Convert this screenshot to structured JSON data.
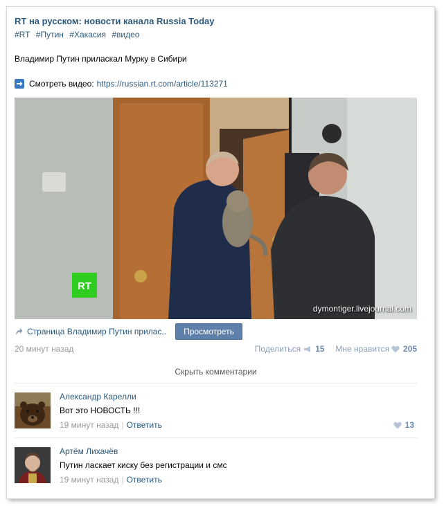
{
  "post": {
    "group_title": "RT на русском: новости канала Russia Today",
    "tags": [
      "#RT",
      "#Путин",
      "#Хакасия",
      "#видео"
    ],
    "text": "Владимир Путин приласкал Мурку в Сибири",
    "watch_label": "Смотреть видео:",
    "watch_link": "https://russian.rt.com/article/113271",
    "video_watermark": "dymontiger.livejournal.com",
    "share_page_text": "Страница Владимир Путин прилас..",
    "view_button": "Просмотреть",
    "time": "20 минут назад",
    "share_label": "Поделиться",
    "share_count": "15",
    "like_label": "Мне нравится",
    "like_count": "205",
    "hide_comments": "Скрыть комментарии"
  },
  "comments": [
    {
      "author": "Александр Карелли",
      "text": "Вот это НОВОСТЬ !!!",
      "time": "19 минут назад",
      "reply": "Ответить",
      "likes": "13"
    },
    {
      "author": "Артём Лихачёв",
      "text": "Путин ласкает киску без регистрации и смс",
      "time": "19 минут назад",
      "reply": "Ответить"
    }
  ],
  "icons": {
    "arrow": "right-arrow-icon",
    "share": "share-icon",
    "heart": "heart-icon",
    "megaphone": "megaphone-icon"
  },
  "colors": {
    "link": "#2b587a",
    "button": "#5e80aa",
    "meta": "#999999"
  }
}
